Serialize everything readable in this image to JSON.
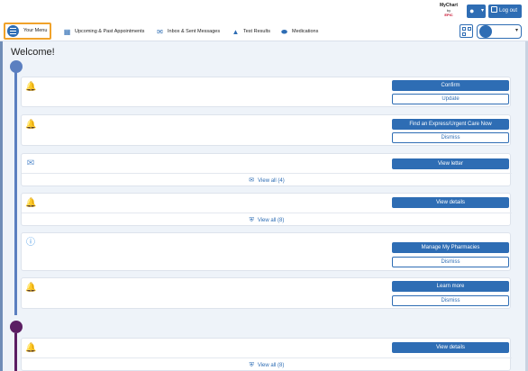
{
  "header": {
    "logo_line1": "MyChart",
    "logo_line2": "by",
    "logo_line3": "EPIC",
    "language_icon": "globe-icon",
    "logout_label": "Log out",
    "menu_label": "Your Menu",
    "nav": [
      {
        "label": "Upcoming & Past Appointments",
        "icon": "calendar-icon"
      },
      {
        "label": "Inbox & Sent Messages",
        "icon": "envelope-icon"
      },
      {
        "label": "Test Results",
        "icon": "flask-icon"
      },
      {
        "label": "Medications",
        "icon": "pill-icon"
      }
    ]
  },
  "welcome": "Welcome!",
  "cards": [
    {
      "icon": "bell-icon",
      "buttons": [
        {
          "label": "Confirm"
        },
        {
          "label": "Update"
        }
      ]
    },
    {
      "icon": "bell-icon",
      "buttons": [
        {
          "label": "Find an Express/Urgent Care Now"
        },
        {
          "label": "Dismiss"
        }
      ]
    },
    {
      "icon": "envelope-icon",
      "buttons": [
        {
          "label": "View letter"
        }
      ],
      "view_all": "View all (4)"
    },
    {
      "icon": "alert-bell-icon",
      "buttons": [
        {
          "label": "View details"
        }
      ],
      "view_all": "View all (8)"
    },
    {
      "icon": "info-icon",
      "buttons": [
        {
          "label": "Manage My Pharmacies"
        },
        {
          "label": "Dismiss"
        }
      ]
    },
    {
      "icon": "bell-icon",
      "buttons": [
        {
          "label": "Learn more"
        },
        {
          "label": "Dismiss"
        }
      ]
    },
    {
      "icon": "alert-bell-icon",
      "buttons": [
        {
          "label": "View details"
        }
      ],
      "view_all": "View all (8)"
    }
  ],
  "colors": {
    "accent": "#2e6db4",
    "menu_highlight": "#f0a22a",
    "timeline_1": "#5b7fc0",
    "timeline_2": "#5b1e63"
  }
}
